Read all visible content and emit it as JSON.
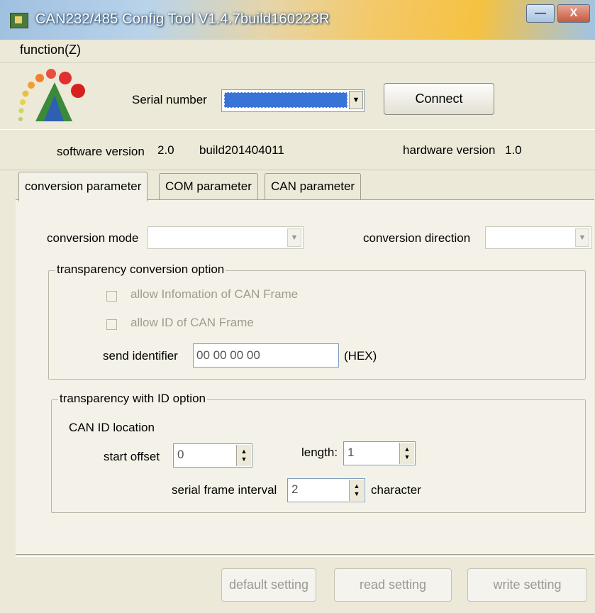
{
  "window": {
    "title": "CAN232/485 Config Tool V1.4.7build160223R",
    "minimize_glyph": "—",
    "close_glyph": "X"
  },
  "menu": {
    "function_label": "function(Z)"
  },
  "header": {
    "serial_label": "Serial number",
    "connect_label": "Connect",
    "software_version_label": "software version",
    "software_version_value": "2.0",
    "software_build": "build201404011",
    "hardware_version_label": "hardware version",
    "hardware_version_value": "1.0"
  },
  "tabs": [
    {
      "label": "conversion parameter",
      "active": true
    },
    {
      "label": "COM parameter",
      "active": false
    },
    {
      "label": "CAN parameter",
      "active": false
    }
  ],
  "conversion": {
    "mode_label": "conversion mode",
    "mode_value": "",
    "direction_label": "conversion direction",
    "direction_value": ""
  },
  "transparency_group": {
    "title": "transparency conversion option",
    "allow_info_label": "allow Infomation of CAN Frame",
    "allow_id_label": "allow ID of CAN Frame",
    "send_identifier_label": "send identifier",
    "send_identifier_value": "00 00 00 00",
    "hex_label": "(HEX)"
  },
  "id_group": {
    "title": "transparency with ID option",
    "can_id_location_label": "CAN ID location",
    "start_offset_label": "start offset",
    "start_offset_value": "0",
    "length_label": "length:",
    "length_value": "1",
    "interval_label": "serial frame interval",
    "interval_value": "2",
    "character_label": "character"
  },
  "footer": {
    "default_label": "default setting",
    "read_label": "read setting",
    "write_label": "write setting"
  },
  "colors": {
    "accent": "#3874d8",
    "background": "#ece9d8",
    "panel": "#f4f2e8"
  }
}
